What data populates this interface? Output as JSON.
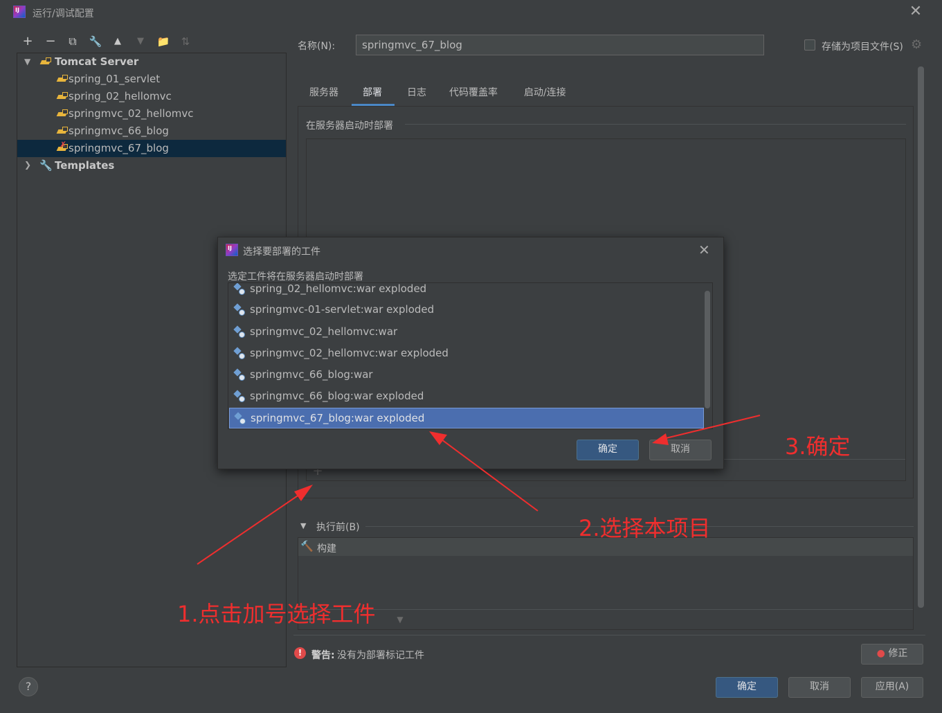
{
  "window": {
    "title": "运行/调试配置",
    "close_glyph": "✕"
  },
  "toolbar": {
    "add": "+",
    "remove": "−",
    "copy": "⧉",
    "edit": "🔧",
    "up": "▲",
    "down": "▼",
    "folder": "📁",
    "sort": "⇅"
  },
  "tree": {
    "group_label": "Tomcat Server",
    "items": [
      "spring_01_servlet",
      "spring_02_hellomvc",
      "springmvc_02_hellomvc",
      "springmvc_66_blog",
      "springmvc_67_blog"
    ],
    "selected": "springmvc_67_blog",
    "templates_label": "Templates"
  },
  "form": {
    "name_label": "名称(N):",
    "name_value": "springmvc_67_blog",
    "store_label": "存储为项目文件(S)"
  },
  "tabs": [
    "服务器",
    "部署",
    "日志",
    "代码覆盖率",
    "启动/连接"
  ],
  "active_tab": "部署",
  "deploy": {
    "section_title": "在服务器启动时部署"
  },
  "before_launch": {
    "label": "执行前(B)",
    "task": "构建"
  },
  "warning": {
    "prefix": "警告:",
    "text": "没有为部署标记工件"
  },
  "buttons": {
    "fix": "修正",
    "ok": "确定",
    "cancel": "取消",
    "apply": "应用(A)",
    "help": "?"
  },
  "modal": {
    "title": "选择要部署的工件",
    "description": "选定工件将在服务器启动时部署",
    "artifacts": [
      "spring_02_hellomvc:war exploded",
      "springmvc-01-servlet:war exploded",
      "springmvc_02_hellomvc:war",
      "springmvc_02_hellomvc:war exploded",
      "springmvc_66_blog:war",
      "springmvc_66_blog:war exploded",
      "springmvc_67_blog:war exploded"
    ],
    "selected_artifact": "springmvc_67_blog:war exploded",
    "ok": "确定",
    "cancel": "取消"
  },
  "annotations": {
    "step1": "1.点击加号选择工件",
    "step2": "2.选择本项目",
    "step3": "3.确定",
    "color": "#ef2e2e"
  },
  "colors": {
    "background": "#3c3f41",
    "selection": "#0d293e",
    "list_selection": "#4b6eaf",
    "primary_button": "#365880",
    "tab_accent": "#4a88c7"
  }
}
